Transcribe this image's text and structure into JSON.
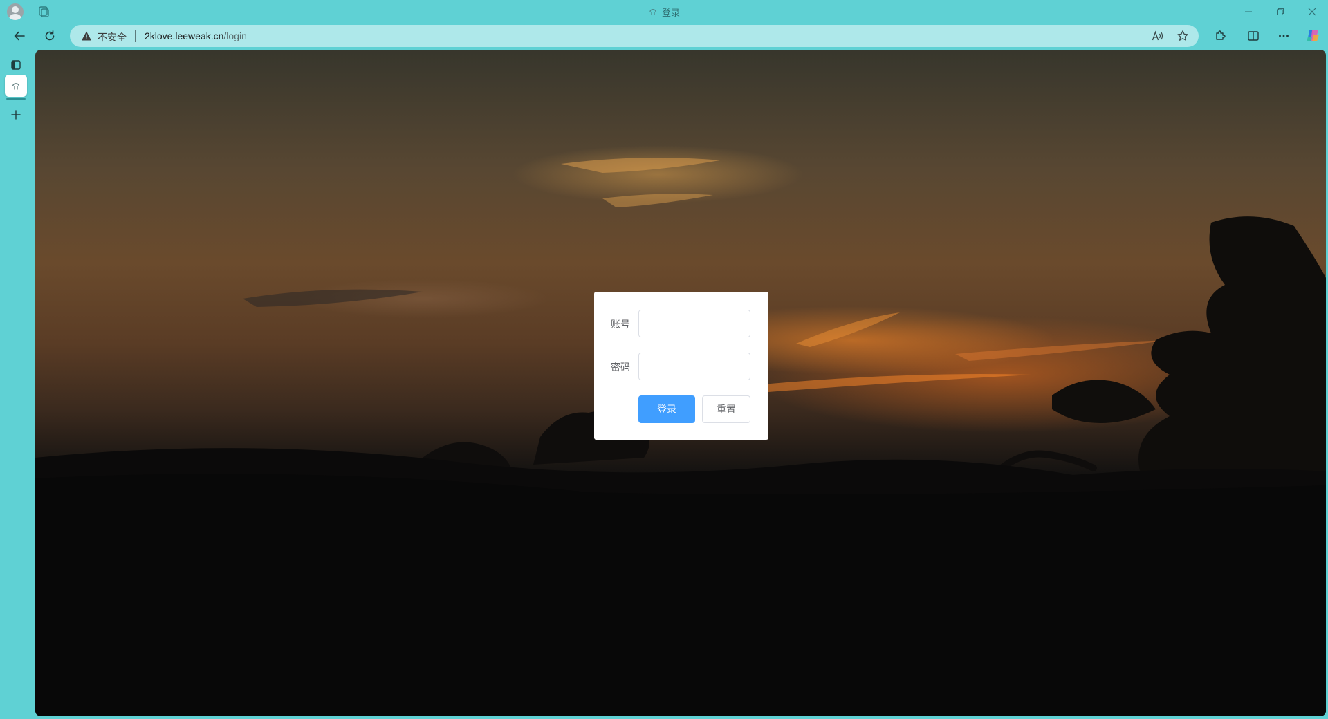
{
  "browser": {
    "window_title": "登录",
    "address_bar": {
      "security_label": "不安全",
      "url_host": "2klove.leeweak.cn",
      "url_path": "/login"
    },
    "icons": [
      "profile-icon",
      "workspaces-icon",
      "back-icon",
      "reload-icon",
      "warning-icon",
      "read-aloud-icon",
      "favorite-star-icon",
      "extensions-icon",
      "split-screen-icon",
      "more-icon",
      "copilot-icon",
      "tab-actions-icon",
      "new-tab-icon",
      "minimize-icon",
      "maximize-icon",
      "close-icon"
    ],
    "colors": {
      "chrome": "#5fd1d4",
      "address_bar": "#aee8ea"
    }
  },
  "login": {
    "account_label": "账号",
    "account_value": "",
    "password_label": "密码",
    "password_value": "",
    "login_button": "登录",
    "reset_button": "重置",
    "colors": {
      "primary": "#409eff",
      "card": "#ffffff"
    }
  }
}
